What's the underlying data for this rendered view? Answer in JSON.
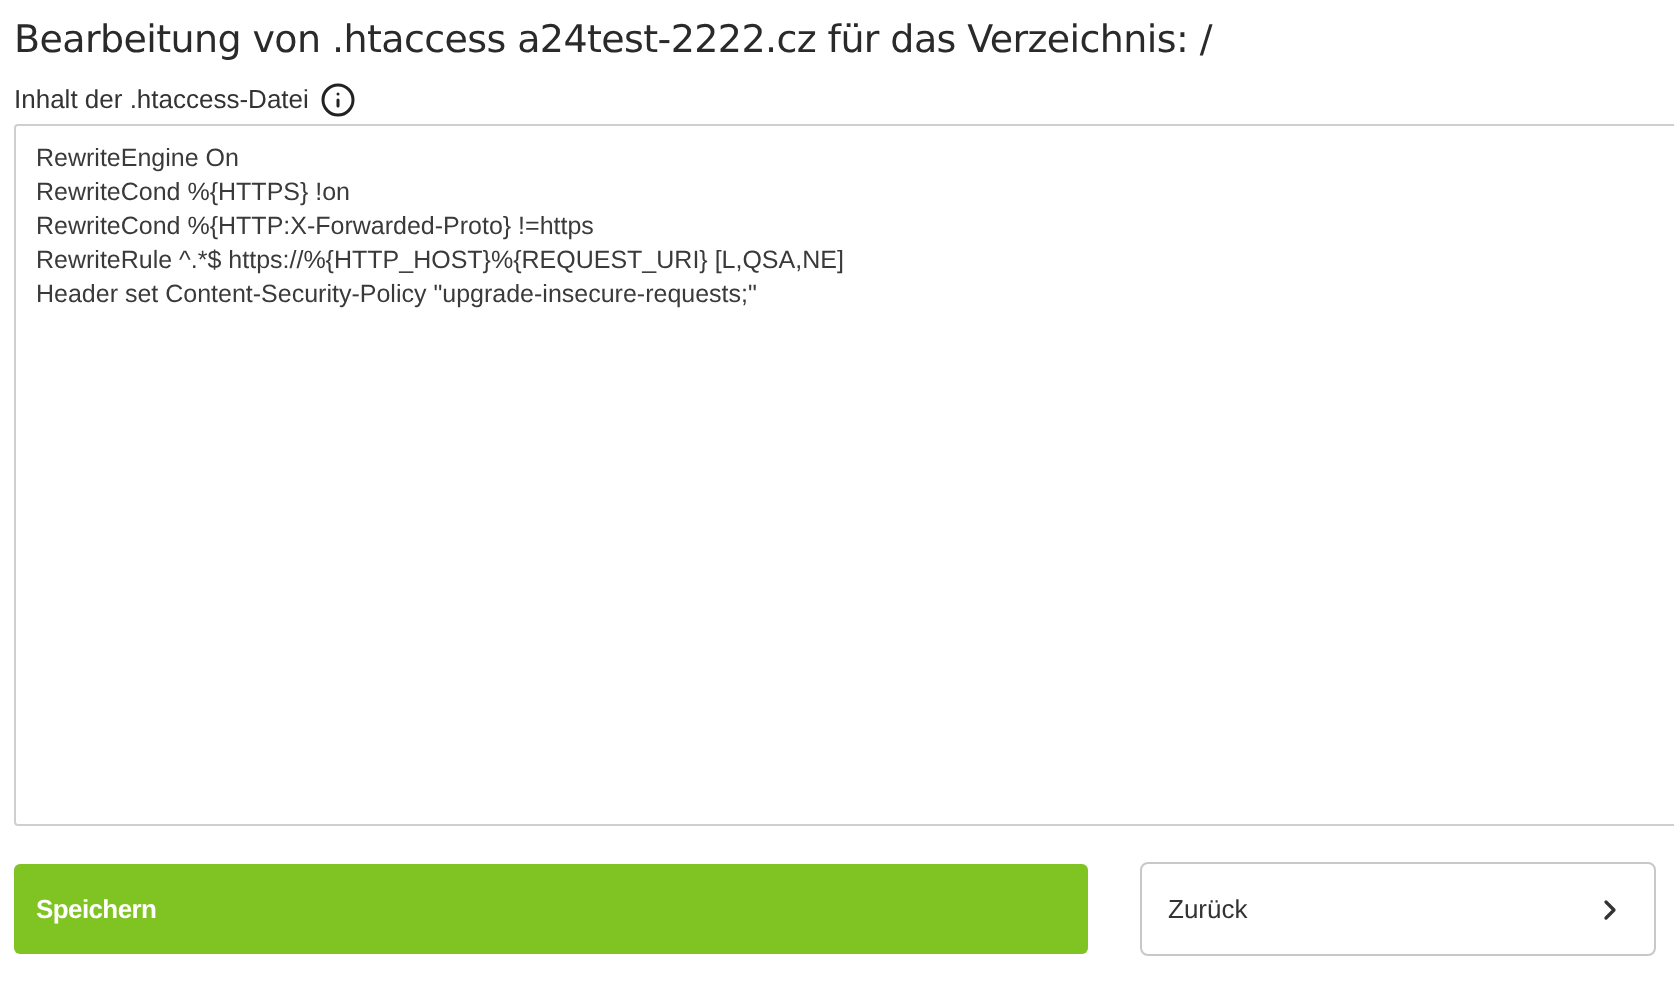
{
  "title": "Bearbeitung von .htaccess a24test-2222.cz für das Verzeichnis: /",
  "field_label": "Inhalt der .htaccess-Datei",
  "content": [
    "RewriteEngine On",
    "RewriteCond %{HTTPS} !on",
    "RewriteCond %{HTTP:X-Forwarded-Proto} !=https",
    "RewriteRule ^.*$ https://%{HTTP_HOST}%{REQUEST_URI} [L,QSA,NE]",
    "Header set Content-Security-Policy \"upgrade-insecure-requests;\""
  ],
  "buttons": [
    {
      "label": "Speichern",
      "kind": "primary"
    },
    {
      "label": "Zurück",
      "kind": "secondary"
    }
  ]
}
